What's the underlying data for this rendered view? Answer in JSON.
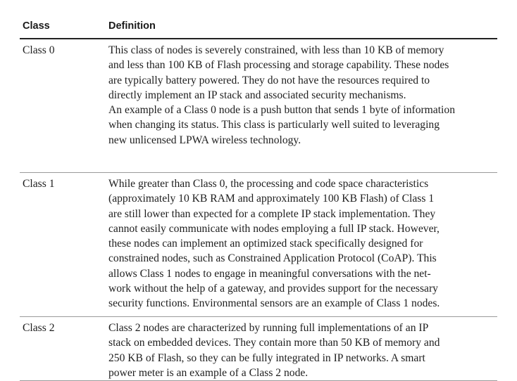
{
  "table": {
    "headers": [
      "Class",
      "Definition"
    ],
    "rows": [
      {
        "class": "Class 0",
        "definition_lines": [
          "This class of nodes is severely constrained, with less than 10 KB of memory",
          "and less than 100 KB of Flash processing and storage capability. These nodes",
          "are typically battery powered. They do not have the resources required to",
          "directly implement an IP stack and associated security mechanisms.",
          "An example of a Class 0 node is a push button that sends 1 byte of information",
          "when changing its status. This class is particularly well suited to leveraging",
          "new unlicensed LPWA wireless technology."
        ]
      },
      {
        "class": "Class 1",
        "definition_lines": [
          "While greater than Class 0, the processing and code space characteristics",
          "(approximately 10 KB RAM and approximately 100 KB Flash) of Class 1",
          "are still lower than expected for a complete IP stack implementation. They",
          "cannot easily communicate with nodes employing a full IP stack. However,",
          "these nodes can implement an optimized stack specifically designed for",
          "constrained nodes, such as Constrained Application Protocol (CoAP). This",
          "allows Class 1 nodes to engage in meaningful conversations with the net-",
          "work without the help of a gateway, and provides support for the necessary",
          "security functions. Environmental sensors are an example of Class 1 nodes."
        ]
      },
      {
        "class": "Class 2",
        "definition_lines": [
          "Class 2 nodes are characterized by running full implementations of an IP",
          "stack on embedded devices. They contain more than 50 KB of memory and",
          "250 KB of Flash, so they can be fully integrated in IP networks. A smart",
          "power meter is an example of a Class 2 node."
        ]
      }
    ]
  }
}
